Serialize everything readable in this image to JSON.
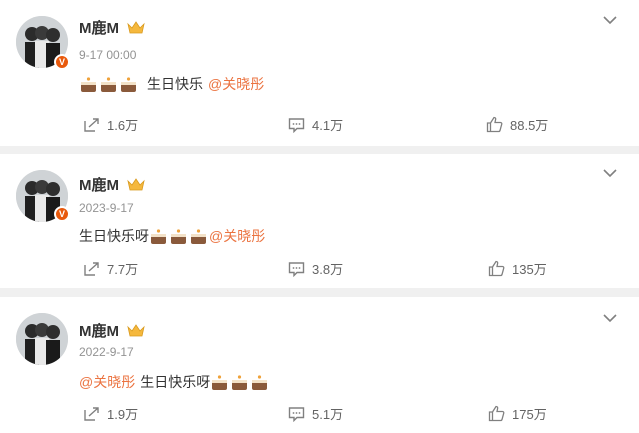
{
  "posts": [
    {
      "author": "M鹿M",
      "time": "9-17 00:00",
      "text_before": "",
      "text": "生日快乐",
      "mention": "@关晓彤",
      "repost": "1.6万",
      "comments": "4.1万",
      "likes": "88.5万"
    },
    {
      "author": "M鹿M",
      "time": "2023-9-17",
      "text_before": "",
      "text": "生日快乐呀",
      "mention": "@关晓彤",
      "repost": "7.7万",
      "comments": "3.8万",
      "likes": "135万"
    },
    {
      "author": "M鹿M",
      "time": "2022-9-17",
      "mention_first": "@关晓彤",
      "text": "生日快乐呀",
      "repost": "1.9万",
      "comments": "5.1万",
      "likes": "175万"
    }
  ],
  "colors": {
    "mention": "#eb7340",
    "badge": "#e8590c",
    "crown": "#f5b83d",
    "background": "#f0f0f0"
  },
  "icons": [
    "avatar-photo",
    "v-badge",
    "crown-icon",
    "chevron-down-icon",
    "birthday-cake-emoji",
    "repost-icon",
    "comment-icon",
    "like-icon"
  ]
}
